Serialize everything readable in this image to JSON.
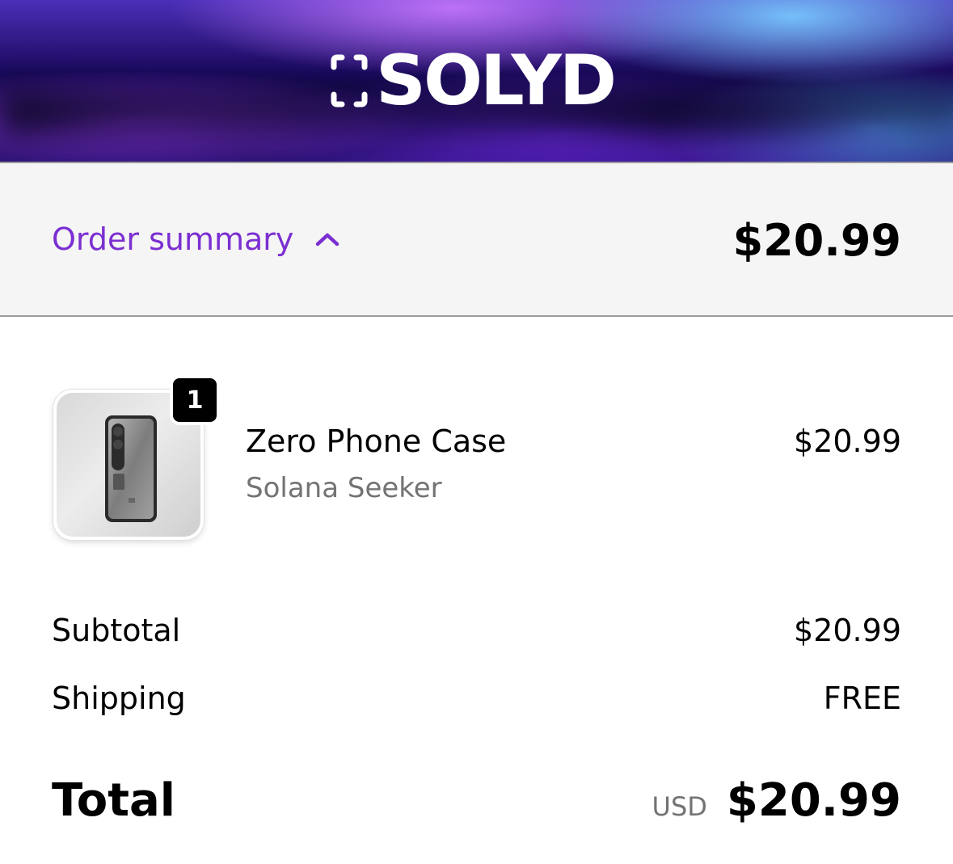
{
  "brand": {
    "name": "SOLYD",
    "logo_icon": "bracket-logo-icon"
  },
  "order_summary": {
    "toggle_label": "Order summary",
    "toggle_icon": "chevron-up-icon",
    "total": "$20.99",
    "accent_color": "#7b2fd1"
  },
  "items": [
    {
      "name": "Zero Phone Case",
      "variant": "Solana Seeker",
      "price": "$20.99",
      "quantity": "1"
    }
  ],
  "totals": {
    "subtotal_label": "Subtotal",
    "subtotal_value": "$20.99",
    "shipping_label": "Shipping",
    "shipping_value": "FREE",
    "total_label": "Total",
    "currency": "USD",
    "total_value": "$20.99"
  }
}
